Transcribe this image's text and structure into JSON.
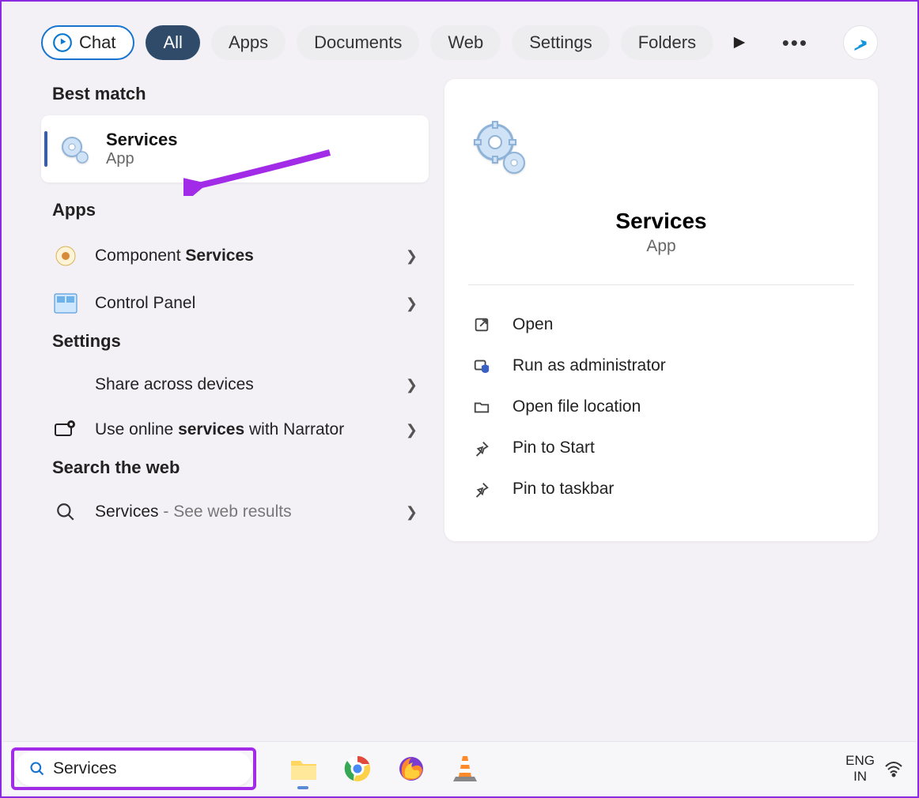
{
  "tabs": {
    "chat": "Chat",
    "all": "All",
    "apps": "Apps",
    "documents": "Documents",
    "web": "Web",
    "settings": "Settings",
    "folders": "Folders"
  },
  "sections": {
    "best_match": "Best match",
    "apps": "Apps",
    "settings": "Settings",
    "search_web": "Search the web"
  },
  "best_match": {
    "title": "Services",
    "subtitle": "App"
  },
  "apps_results": [
    {
      "prefix": "Component ",
      "bold": "Services"
    },
    {
      "prefix": "Control Panel",
      "bold": ""
    }
  ],
  "settings_results": [
    {
      "text": "Share across devices"
    },
    {
      "prefix": "Use online ",
      "bold": "services",
      "suffix": " with Narrator"
    }
  ],
  "web_result": {
    "term": "Services",
    "suffix": " - See web results"
  },
  "preview": {
    "title": "Services",
    "subtitle": "App",
    "actions": [
      {
        "id": "open",
        "label": "Open"
      },
      {
        "id": "run-admin",
        "label": "Run as administrator"
      },
      {
        "id": "open-loc",
        "label": "Open file location"
      },
      {
        "id": "pin-start",
        "label": "Pin to Start"
      },
      {
        "id": "pin-taskbar",
        "label": "Pin to taskbar"
      }
    ]
  },
  "taskbar": {
    "search_value": "Services",
    "lang_top": "ENG",
    "lang_bottom": "IN"
  }
}
